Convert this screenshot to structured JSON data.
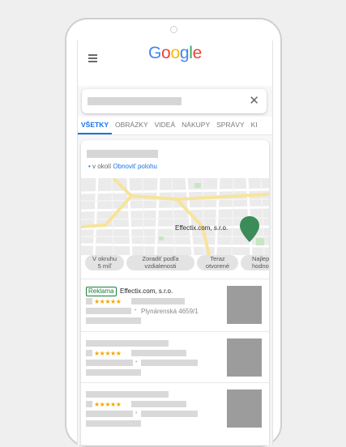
{
  "logo": {
    "text": "Google",
    "letters": [
      {
        "ch": "G",
        "color": "#4285F4"
      },
      {
        "ch": "o",
        "color": "#EA4335"
      },
      {
        "ch": "o",
        "color": "#FBBC05"
      },
      {
        "ch": "g",
        "color": "#4285F4"
      },
      {
        "ch": "l",
        "color": "#34A853"
      },
      {
        "ch": "e",
        "color": "#EA4335"
      }
    ]
  },
  "search": {
    "clear_icon": "close-icon",
    "clear_glyph": "✕"
  },
  "tabs": [
    {
      "label": "VŠETKY",
      "active": true
    },
    {
      "label": "OBRÁZKY",
      "active": false
    },
    {
      "label": "VIDEÁ",
      "active": false
    },
    {
      "label": "NÁKUPY",
      "active": false
    },
    {
      "label": "SPRÁVY",
      "active": false
    },
    {
      "label": "KI",
      "active": false
    }
  ],
  "local": {
    "location_prefix": "v okolí",
    "update_location": "Obnoviť polohu",
    "map_pin_label": "Effectix.com, s.r.o.",
    "filters": [
      {
        "line1": "V okruhu",
        "line2": "5 míľ"
      },
      {
        "line1": "Zoradiť podľa",
        "line2": "vzdialenosti"
      },
      {
        "line1": "Teraz",
        "line2": "otvorené"
      },
      {
        "line1": "Najlepš",
        "line2": "hodnote"
      }
    ],
    "results": [
      {
        "ad_label": "Reklama",
        "name": "Effectix.com, s.r.o.",
        "stars": "★★★★★",
        "address": "Plynárenská 4659/1"
      },
      {
        "stars": "★★★★★"
      },
      {
        "stars": "★★★★★"
      }
    ]
  },
  "colors": {
    "accent": "#1a73e8",
    "ad_green": "#188038",
    "star": "#f4a700",
    "pin": "#3c8c5a",
    "map_road_yellow": "#f7e49b"
  }
}
